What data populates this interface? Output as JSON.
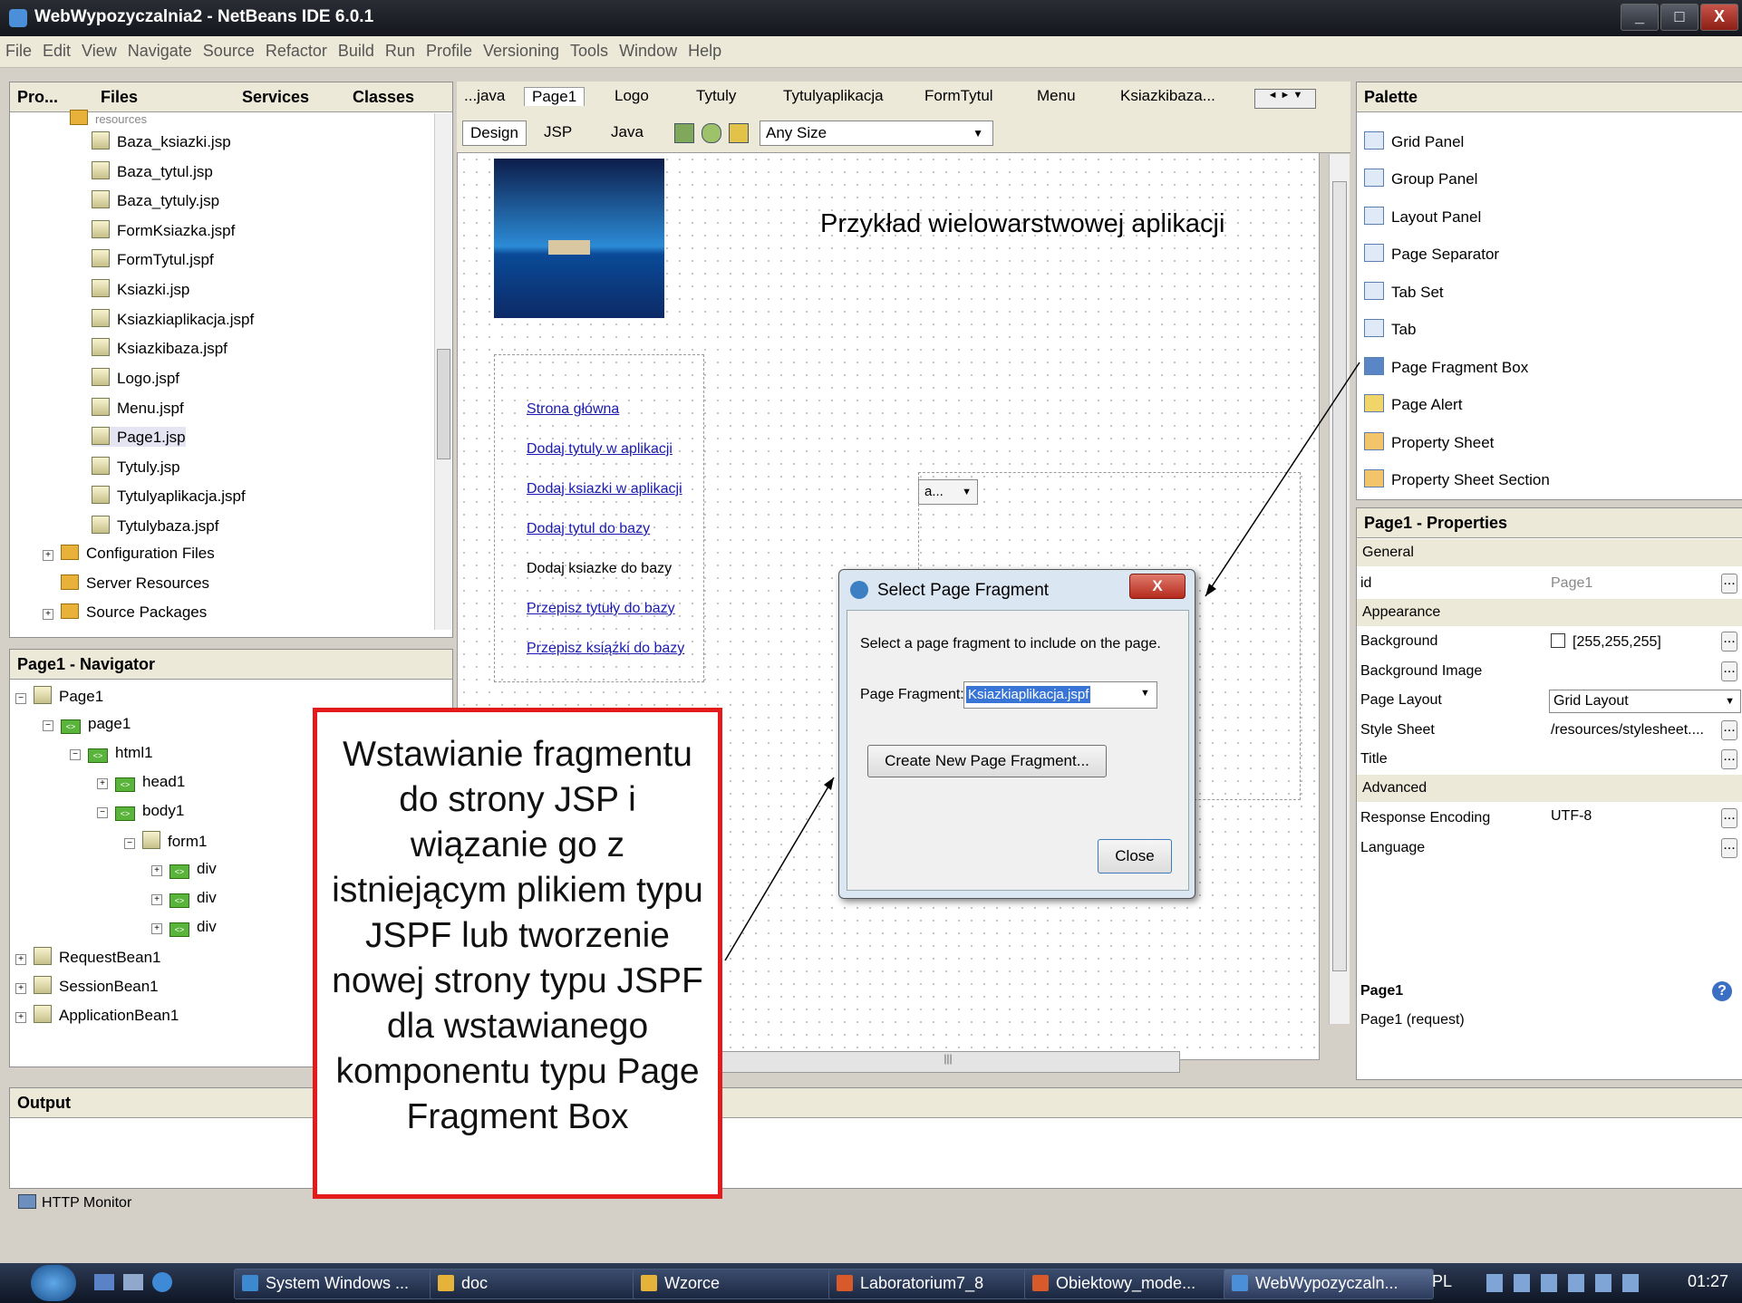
{
  "window": {
    "title": "WebWypozyczalnia2 - NetBeans IDE 6.0.1",
    "controls": [
      "_",
      "□",
      "X"
    ]
  },
  "menu": [
    "File",
    "Edit",
    "View",
    "Navigate",
    "Source",
    "Refactor",
    "Build",
    "Run",
    "Profile",
    "Versioning",
    "Tools",
    "Window",
    "Help"
  ],
  "project_tabs": [
    "Pro...",
    "Files",
    "Services",
    "Classes"
  ],
  "files": [
    "resources",
    "Baza_ksiazki.jsp",
    "Baza_tytul.jsp",
    "Baza_tytuly.jsp",
    "FormKsiazka.jspf",
    "FormTytul.jspf",
    "Ksiazki.jsp",
    "Ksiazkiaplikacja.jspf",
    "Ksiazkibaza.jspf",
    "Logo.jspf",
    "Menu.jspf",
    "Page1.jsp",
    "Tytuly.jsp",
    "Tytulyaplikacja.jspf",
    "Tytulybaza.jspf",
    "Configuration Files",
    "Server Resources",
    "Source Packages"
  ],
  "navigator": {
    "title": "Page1 - Navigator",
    "items": [
      "Page1",
      "page1",
      "html1",
      "head1",
      "body1",
      "form1",
      "div",
      "div",
      "div",
      "RequestBean1",
      "SessionBean1",
      "ApplicationBean1"
    ]
  },
  "editor": {
    "tabs": [
      "...java",
      "Page1",
      "Logo",
      "Tytuly",
      "Tytulyaplikacja",
      "FormTytul",
      "Menu",
      "Ksiazkibaza..."
    ],
    "modes": [
      "Design",
      "JSP",
      "Java"
    ],
    "size_select": "Any Size",
    "page_heading": "Przykład wielowarstwowej aplikacji",
    "links": [
      "Strona główna",
      "Dodaj tytuly w aplikacji",
      "Dodaj ksiazki w aplikacji",
      "Dodaj tytul do bazy",
      "Dodaj ksiazke do bazy",
      "Przepisz tytuły do bazy",
      "Przepisz książki do bazy"
    ],
    "dropdown_value": "a..."
  },
  "palette": {
    "title": "Palette",
    "items": [
      "Grid Panel",
      "Group Panel",
      "Layout Panel",
      "Page Separator",
      "Tab Set",
      "Tab",
      "Page Fragment Box",
      "Page Alert",
      "Property Sheet",
      "Property Sheet Section"
    ]
  },
  "properties": {
    "title": "Page1 - Properties",
    "general": "General",
    "id_label": "id",
    "id_value": "Page1",
    "appearance": "Appearance",
    "background_label": "Background",
    "background_value": "[255,255,255]",
    "bgimage_label": "Background Image",
    "layout_label": "Page Layout",
    "layout_value": "Grid Layout",
    "stylesheet_label": "Style Sheet",
    "stylesheet_value": "/resources/stylesheet....",
    "title_label": "Title",
    "advanced": "Advanced",
    "encoding_label": "Response Encoding",
    "encoding_value": "UTF-8",
    "language_label": "Language",
    "footer_title": "Page1",
    "footer_desc": "Page1 (request)"
  },
  "dialog": {
    "title": "Select Page Fragment",
    "message": "Select a page fragment to include on the page.",
    "field_label": "Page Fragment:",
    "field_value": "Ksiazkiaplikacja.jspf",
    "create_button": "Create New Page Fragment...",
    "close_button": "Close"
  },
  "output": {
    "title": "Output",
    "http_monitor": "HTTP Monitor"
  },
  "annotation": "Wstawianie fragmentu do strony JSP i wiązanie go z istniejącym plikiem typu JSPF lub tworzenie nowej strony typu JSPF dla wstawianego komponentu typu Page Fragment Box",
  "taskbar": {
    "items": [
      "System Windows ...",
      "doc",
      "Wzorce",
      "Laboratorium7_8",
      "Obiektowy_mode...",
      "WebWypozyczaln..."
    ],
    "lang": "PL",
    "clock": "01:27"
  }
}
